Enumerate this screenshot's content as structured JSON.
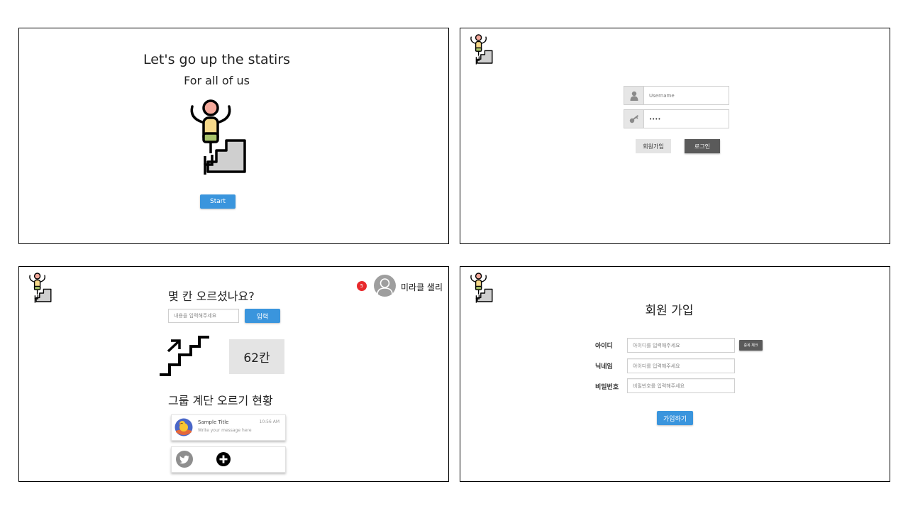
{
  "intro": {
    "title": "Let's go up the statirs",
    "subtitle": "For all of us",
    "start_button": "Start"
  },
  "login": {
    "username_placeholder": "Username",
    "password_value": "••••",
    "signup_button": "회원가입",
    "login_button": "로그인"
  },
  "main": {
    "question": "몇 칸 오르셨나요?",
    "input_placeholder": "내용을 입력해주세요",
    "submit_button": "입력",
    "step_count": "62칸",
    "group_heading": "그룹 계단 오르기 현황",
    "notification_count": "5",
    "user_name": "미라클 샐리",
    "card": {
      "title": "Sample Title",
      "time": "10:56 AM",
      "message": "Write your message here"
    }
  },
  "signup": {
    "title": "회원 가입",
    "id_label": "아이디",
    "id_placeholder": "아이디를 입력해주세요",
    "duplicate_check_button": "중복 체크",
    "nickname_label": "닉네임",
    "nickname_placeholder": "아이디를 입력해주세요",
    "password_label": "비밀번호",
    "password_placeholder": "비밀번호를 입력해주세요",
    "submit_button": "가입하기"
  },
  "colors": {
    "accent": "#3a95dd",
    "dark_button": "#5a5a5a",
    "light_button": "#e4e4e4",
    "badge": "#e8292c",
    "stair_fill": "#cfcfcf",
    "head": "#f4a99b",
    "body": "#f6d98a",
    "leg": "#a9c46c"
  },
  "icons": [
    "stairs-climber-logo",
    "user-icon",
    "key-icon",
    "avatar-icon",
    "stairs-arrow-icon",
    "duck-avatar",
    "twitter-icon",
    "plus-circle-icon"
  ]
}
